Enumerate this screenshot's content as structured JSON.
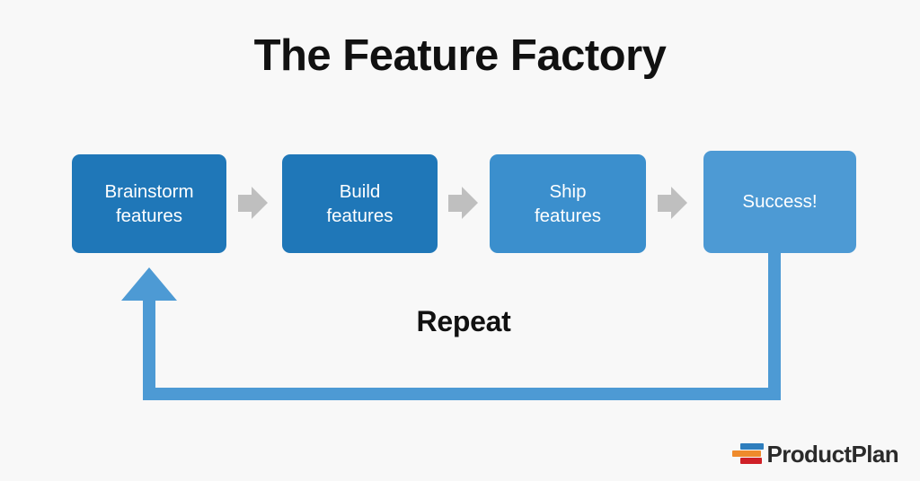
{
  "title": "The Feature Factory",
  "background_color": "#f8f8f8",
  "diagram": {
    "steps": [
      {
        "label_line1": "Brainstorm",
        "label_line2": "features",
        "color": "#1f77b8"
      },
      {
        "label_line1": "Build",
        "label_line2": "features",
        "color": "#1f77b8"
      },
      {
        "label_line1": "Ship",
        "label_line2": "features",
        "color": "#3b8fcd"
      },
      {
        "label_line1": "Success!",
        "label_line2": "",
        "color": "#4d9ad4"
      }
    ],
    "connector_color": "#bfbfbf",
    "loop_label": "Repeat",
    "loop_color": "#4d9ad4"
  },
  "logo": {
    "text": "ProductPlan",
    "bar_colors": {
      "top": "#2e7ebd",
      "middle": "#ef8b2c",
      "bottom": "#cf2027"
    }
  }
}
